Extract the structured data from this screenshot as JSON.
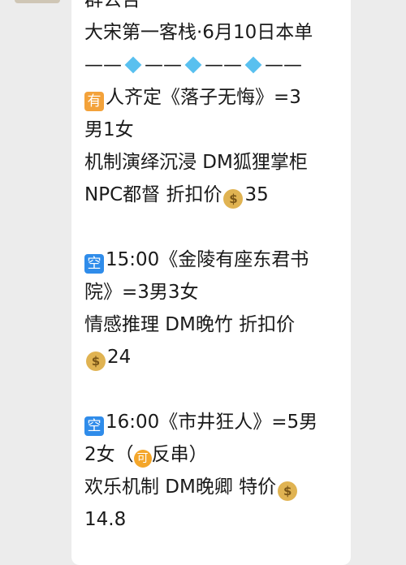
{
  "group_notice": "群公告",
  "header_line": "大宋第一客栈·6月10日本单",
  "divider": "——💎——💎——💎——",
  "sessions": [
    {
      "status_badge": "有",
      "lines": [
        "人齐定《落子无悔》=3",
        "男1女",
        "机制演绎沉浸 DM狐狸掌柜",
        "NPC都督 折扣价"
      ],
      "price": "35"
    },
    {
      "status_badge": "空",
      "lines": [
        "15:00《金陵有座东君书",
        "院》=3男3女",
        "情感推理 DM晚竹 折扣价"
      ],
      "price": "24"
    },
    {
      "status_badge": "空",
      "lines": [
        "16:00《市井狂人》=5男",
        "2女（",
        "反串）",
        "欢乐机制 DM晚卿 特价"
      ],
      "badge_ke": "可",
      "price": "14.8"
    }
  ],
  "icons": {
    "diamond": "gem-icon",
    "money": "money-bag-icon",
    "you": "squared-have-icon",
    "kong": "squared-empty-icon",
    "ke": "circled-acceptable-icon"
  }
}
